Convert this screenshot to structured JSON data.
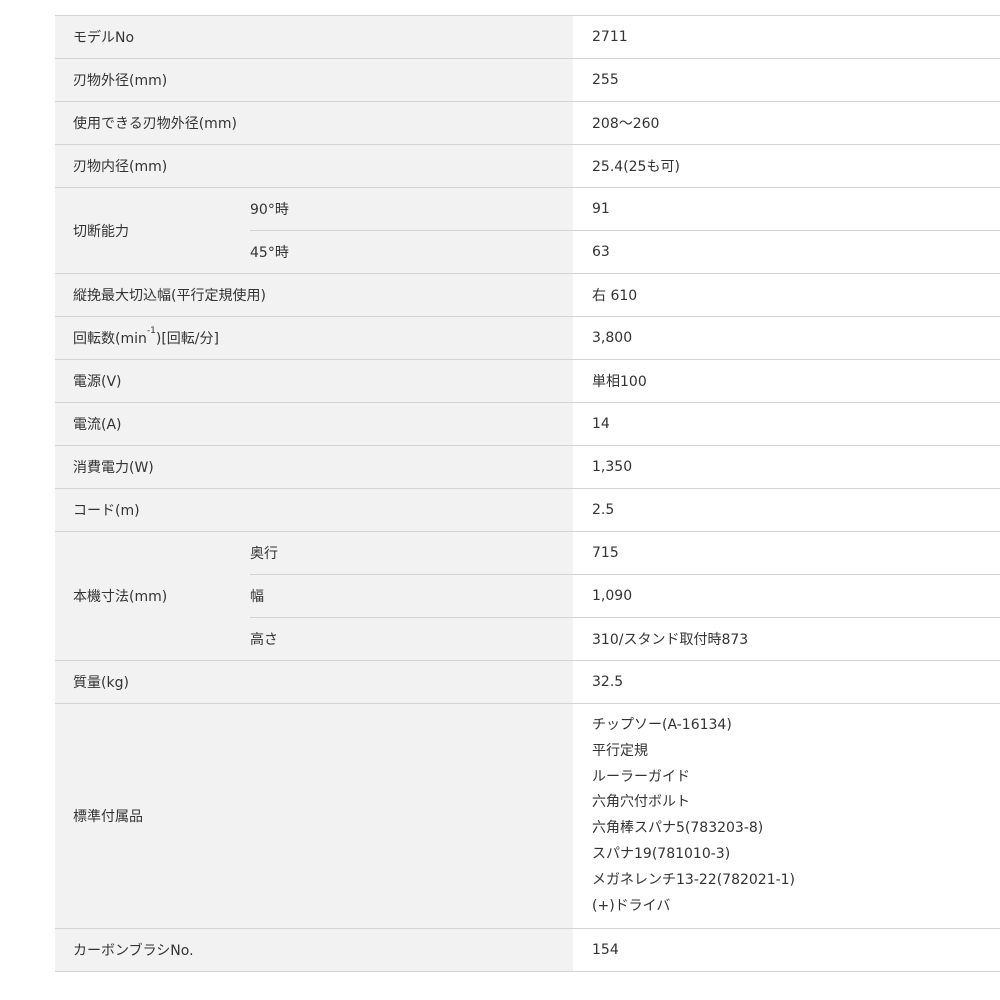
{
  "specs": {
    "model": {
      "label": "モデルNo",
      "value": "2711"
    },
    "blade_outer": {
      "label": "刃物外径(mm)",
      "value": "255"
    },
    "blade_usable": {
      "label": "使用できる刃物外径(mm)",
      "value": "208〜260"
    },
    "blade_inner": {
      "label": "刃物内径(mm)",
      "value": "25.4(25も可)"
    },
    "cutting": {
      "label": "切断能力",
      "rows": [
        {
          "sub": "90°時",
          "value": "91"
        },
        {
          "sub": "45°時",
          "value": "63"
        }
      ]
    },
    "rip": {
      "label": "縦挽最大切込幅(平行定規使用)",
      "value": "右 610"
    },
    "rpm": {
      "label_prefix": "回転数(min",
      "label_sup": "-1",
      "label_suffix": ")[回転/分]",
      "value": "3,800"
    },
    "power_source": {
      "label": "電源(V)",
      "value": "単相100"
    },
    "current": {
      "label": "電流(A)",
      "value": "14"
    },
    "power_consumption": {
      "label": "消費電力(W)",
      "value": "1,350"
    },
    "cord": {
      "label": "コード(m)",
      "value": "2.5"
    },
    "dimensions": {
      "label": "本機寸法(mm)",
      "rows": [
        {
          "sub": "奥行",
          "value": "715"
        },
        {
          "sub": "幅",
          "value": "1,090"
        },
        {
          "sub": "高さ",
          "value": "310/スタンド取付時873"
        }
      ]
    },
    "weight": {
      "label": "質量(kg)",
      "value": "32.5"
    },
    "accessories": {
      "label": "標準付属品",
      "items": [
        "チップソー(A-16134)",
        "平行定規",
        "ルーラーガイド",
        "六角穴付ボルト",
        "六角棒スパナ5(783203-8)",
        "スパナ19(781010-3)",
        "メガネレンチ13-22(782021-1)",
        "(+)ドライバ"
      ]
    },
    "carbon_brush": {
      "label": "カーボンブラシNo.",
      "value": "154"
    }
  }
}
